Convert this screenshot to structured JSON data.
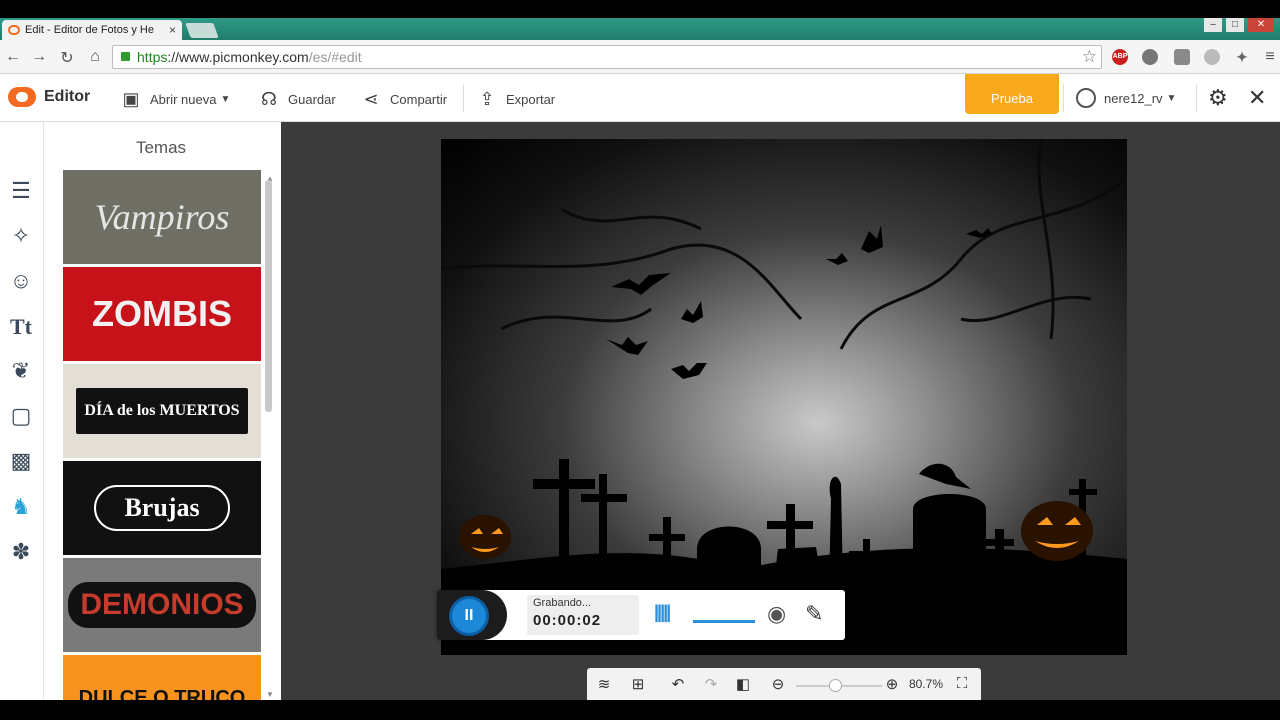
{
  "browser": {
    "tab_title": "Edit - Editor de Fotos y He",
    "tab_close": "×",
    "url_https": "https",
    "url_host": "://www.picmonkey.com",
    "url_path": "/es/#edit",
    "abp_label": "ABP"
  },
  "app": {
    "logo_label": "Editor",
    "open_new": "Abrir nueva",
    "save": "Guardar",
    "share": "Compartir",
    "export": "Exportar",
    "trial": "Prueba",
    "username": "nere12_rv"
  },
  "themes_panel": {
    "title": "Temas",
    "items": [
      {
        "label": "Vampiros",
        "bg": "#6f6f66",
        "fg": "#e6e6e6"
      },
      {
        "label": "ZOMBIS",
        "bg": "#c8121a",
        "fg": "#f1f1f1"
      },
      {
        "label": "DÍA de los MUERTOS",
        "bg": "#e3dfd6",
        "fg": "#ffffff"
      },
      {
        "label": "Brujas",
        "bg": "#111111",
        "fg": "#ffffff"
      },
      {
        "label": "DEMONIOS",
        "bg": "#7a7a7a",
        "fg": "#c73b2c"
      },
      {
        "label": "DULCE O TRUCO",
        "bg": "#f7931e",
        "fg": "#111111"
      }
    ]
  },
  "recorder": {
    "status": "Grabando...",
    "time": "00:00:02"
  },
  "bottom_toolbar": {
    "zoom": "80.7%"
  }
}
